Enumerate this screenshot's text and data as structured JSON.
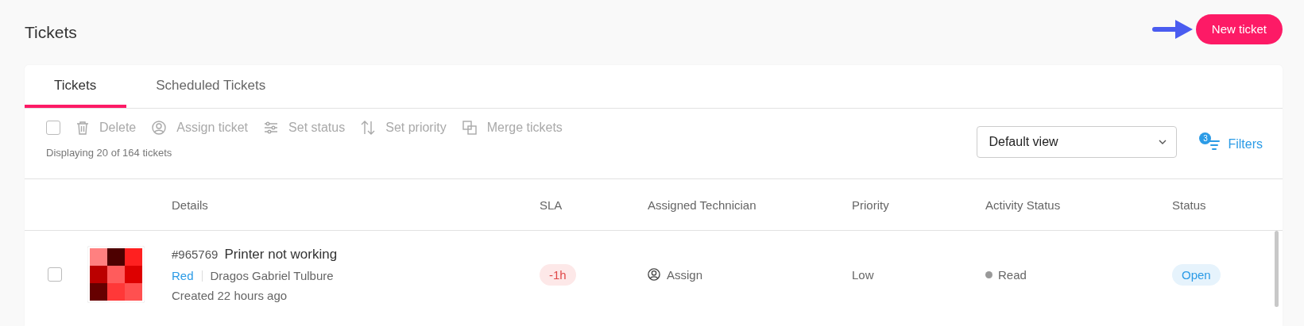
{
  "page": {
    "title": "Tickets",
    "new_button": "New ticket"
  },
  "tabs": [
    {
      "label": "Tickets",
      "selected": true
    },
    {
      "label": "Scheduled Tickets",
      "selected": false
    }
  ],
  "toolbar": {
    "select_all": {
      "checked": false
    },
    "actions": [
      {
        "kind": "delete",
        "label": "Delete",
        "disabled": true
      },
      {
        "kind": "assign",
        "label": "Assign ticket",
        "disabled": true
      },
      {
        "kind": "status",
        "label": "Set status",
        "disabled": true
      },
      {
        "kind": "priority",
        "label": "Set priority",
        "disabled": true
      },
      {
        "kind": "merge",
        "label": "Merge tickets",
        "disabled": true
      }
    ],
    "count_text": "Displaying 20 of 164 tickets",
    "view_select": "Default view",
    "filters": {
      "label": "Filters",
      "badge": "3"
    }
  },
  "table": {
    "columns": [
      "Details",
      "SLA",
      "Assigned Technician",
      "Priority",
      "Activity Status",
      "Status"
    ],
    "rows": [
      {
        "checked": false,
        "id": "#965769",
        "title": "Printer not working",
        "group": "Red",
        "requester": "Dragos Gabriel Tulbure",
        "created": "Created 22 hours ago",
        "sla": "-1h",
        "technician": "Assign",
        "priority": "Low",
        "activity": "Read",
        "status": "Open"
      }
    ]
  }
}
